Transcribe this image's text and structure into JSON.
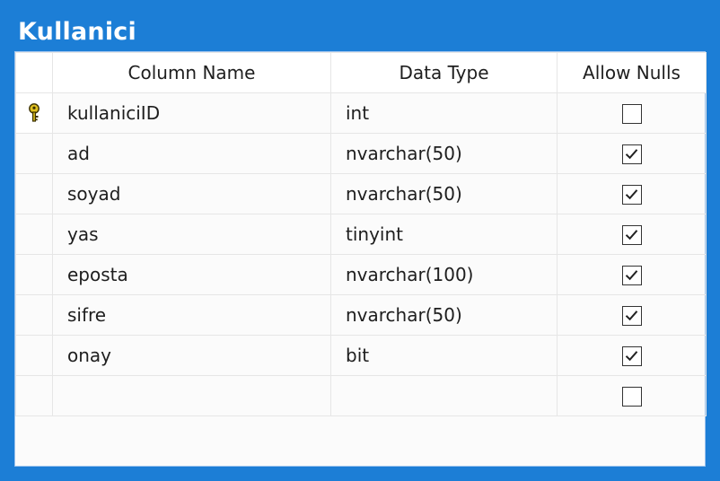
{
  "window": {
    "title": "Kullanici",
    "accent_color": "#1c7ed6"
  },
  "table": {
    "headers": {
      "selector": "",
      "name": "Column Name",
      "type": "Data Type",
      "nulls": "Allow Nulls"
    },
    "rows": [
      {
        "key": true,
        "name": "kullaniciID",
        "type": "int",
        "allow_nulls": false
      },
      {
        "key": false,
        "name": "ad",
        "type": "nvarchar(50)",
        "allow_nulls": true
      },
      {
        "key": false,
        "name": "soyad",
        "type": "nvarchar(50)",
        "allow_nulls": true
      },
      {
        "key": false,
        "name": "yas",
        "type": "tinyint",
        "allow_nulls": true
      },
      {
        "key": false,
        "name": "eposta",
        "type": "nvarchar(100)",
        "allow_nulls": true
      },
      {
        "key": false,
        "name": "sifre",
        "type": "nvarchar(50)",
        "allow_nulls": true
      },
      {
        "key": false,
        "name": "onay",
        "type": "bit",
        "allow_nulls": true
      },
      {
        "key": false,
        "name": "",
        "type": "",
        "allow_nulls": false
      }
    ]
  }
}
